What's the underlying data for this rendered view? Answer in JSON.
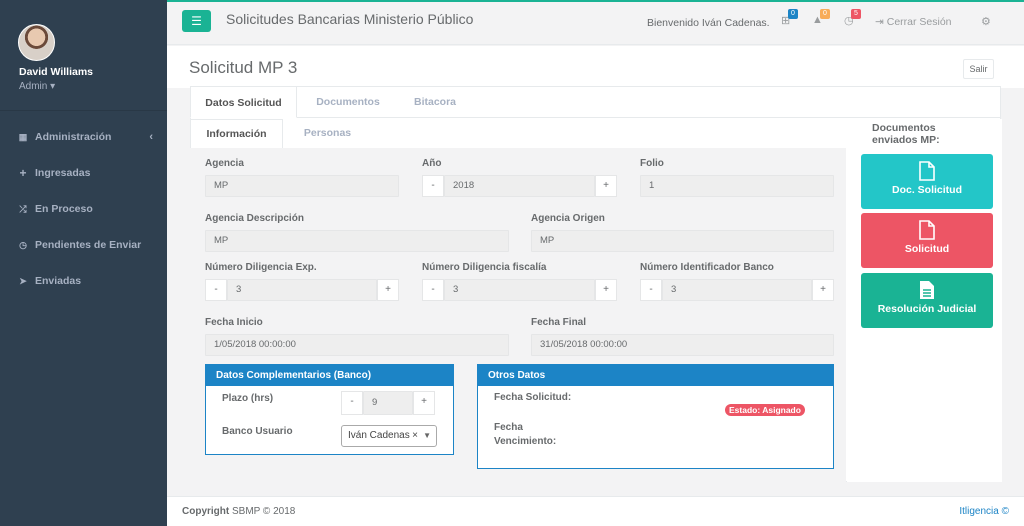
{
  "sidebar": {
    "user_name": "David Williams",
    "user_role": "Admin ▾",
    "items": [
      {
        "label": "Administración",
        "icon": "grid-icon"
      },
      {
        "label": "Ingresadas",
        "icon": "plus-icon"
      },
      {
        "label": "En Proceso",
        "icon": "shuffle-icon"
      },
      {
        "label": "Pendientes de Enviar",
        "icon": "clock-icon"
      },
      {
        "label": "Enviadas",
        "icon": "send-icon"
      }
    ]
  },
  "topbar": {
    "title": "Solicitudes Bancarias Ministerio Público",
    "welcome": "Bienvenido Iván Cadenas.",
    "badges": {
      "plus": "0",
      "warning": "0",
      "clock": "5"
    },
    "logout": "Cerrar Sesión"
  },
  "page": {
    "title": "Solicitud MP 3",
    "exit_label": "Salir"
  },
  "tabs": [
    "Datos Solicitud",
    "Documentos",
    "Bitacora"
  ],
  "subtabs": [
    "Información",
    "Personas"
  ],
  "form": {
    "agencia_label": "Agencia",
    "agencia_value": "MP",
    "anio_label": "Año",
    "anio_value": "2018",
    "folio_label": "Folio",
    "folio_value": "1",
    "agencia_desc_label": "Agencia Descripción",
    "agencia_desc_value": "MP",
    "agencia_origen_label": "Agencia Origen",
    "agencia_origen_value": "MP",
    "num_dil_exp_label": "Número Diligencia Exp.",
    "num_dil_exp_value": "3",
    "num_dil_fisc_label": "Número Diligencia fiscalía",
    "num_dil_fisc_value": "3",
    "num_id_banco_label": "Número Identificador Banco",
    "num_id_banco_value": "3",
    "fecha_inicio_label": "Fecha Inicio",
    "fecha_inicio_value": "1/05/2018 00:00:00",
    "fecha_final_label": "Fecha Final",
    "fecha_final_value": "31/05/2018 00:00:00",
    "minus": "-",
    "plus": "+"
  },
  "datos_complementarios": {
    "title": "Datos Complementarios (Banco)",
    "plazo_label": "Plazo (hrs)",
    "plazo_value": "9",
    "banco_usuario_label": "Banco Usuario",
    "banco_usuario_value": "Iván Cadenas"
  },
  "otros_datos": {
    "title": "Otros Datos",
    "fecha_solicitud_label": "Fecha Solicitud:",
    "estado": "Estado: Asignado",
    "fecha_venc_label_1": "Fecha",
    "fecha_venc_label_2": "Vencimiento:"
  },
  "docs": {
    "title_1": "Documentos",
    "title_2": "enviados MP:",
    "buttons": [
      {
        "label": "Doc. Solicitud",
        "color": "#23c6c8"
      },
      {
        "label": "Solicitud",
        "color": "#ed5565"
      },
      {
        "label": "Resolución Judicial",
        "color": "#1ab394"
      }
    ]
  },
  "footer": {
    "copyright_bold": "Copyright",
    "copyright_rest": " SBMP © 2018",
    "right": "Itligencia ©"
  }
}
